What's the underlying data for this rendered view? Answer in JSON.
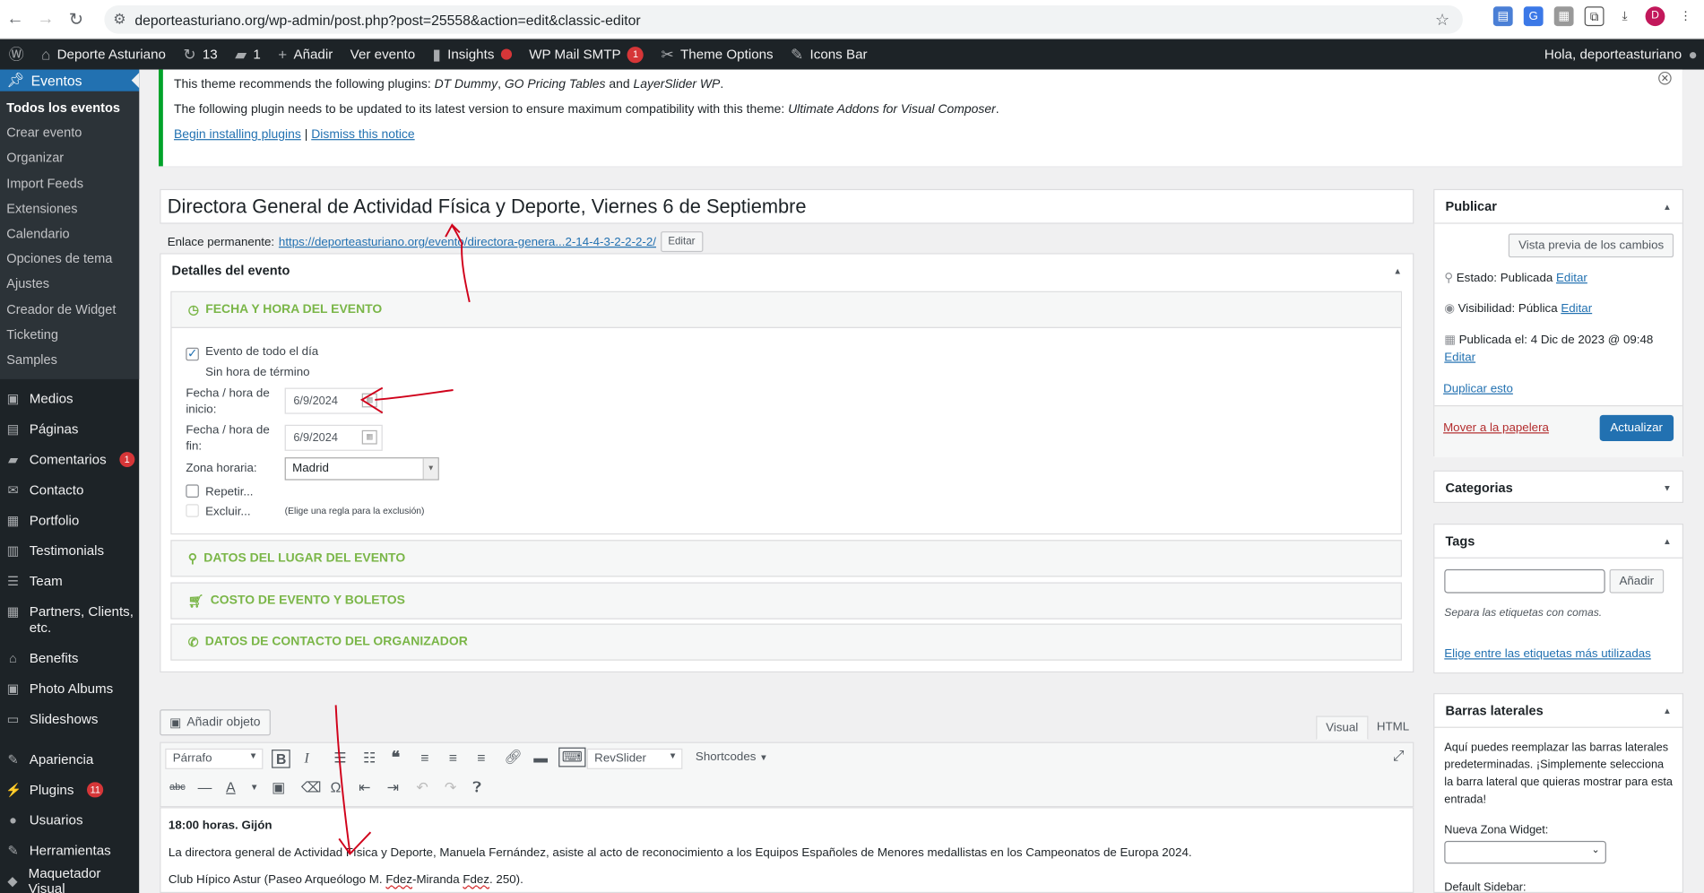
{
  "browser": {
    "url": "deporteasturiano.org/wp-admin/post.php?post=25558&action=edit&classic-editor",
    "avatar_letter": "D"
  },
  "adminbar": {
    "site": "Deporte Asturiano",
    "updates": "13",
    "comments": "1",
    "new": "Añadir",
    "view": "Ver evento",
    "insights": "Insights",
    "smtp": "WP Mail SMTP",
    "smtp_count": "1",
    "theme_options": "Theme Options",
    "icons_bar": "Icons Bar",
    "greeting": "Hola, deporteasturiano"
  },
  "sidebar": {
    "current": "Eventos",
    "submenu": [
      "Todos los eventos",
      "Crear evento",
      "Organizar",
      "Import Feeds",
      "Extensiones",
      "Calendario",
      "Opciones de tema",
      "Ajustes",
      "Creador de Widget",
      "Ticketing",
      "Samples"
    ],
    "items": [
      {
        "label": "Medios",
        "icon": "▣"
      },
      {
        "label": "Páginas",
        "icon": "▤"
      },
      {
        "label": "Comentarios",
        "icon": "▰",
        "badge": "1"
      },
      {
        "label": "Contacto",
        "icon": "✉"
      },
      {
        "label": "Portfolio",
        "icon": "▦"
      },
      {
        "label": "Testimonials",
        "icon": "▥"
      },
      {
        "label": "Team",
        "icon": "☰"
      },
      {
        "label": "Partners, Clients, etc.",
        "icon": "▦"
      },
      {
        "label": "Benefits",
        "icon": "⌂"
      },
      {
        "label": "Photo Albums",
        "icon": "▣"
      },
      {
        "label": "Slideshows",
        "icon": "▭"
      },
      {
        "label": "Apariencia",
        "icon": "✎"
      },
      {
        "label": "Plugins",
        "icon": "⚡",
        "badge": "11"
      },
      {
        "label": "Usuarios",
        "icon": "●"
      },
      {
        "label": "Herramientas",
        "icon": "✎"
      },
      {
        "label": "Maquetador Visual",
        "icon": "◆"
      }
    ]
  },
  "notice": {
    "line1_pre": "This theme recommends the following plugins: ",
    "line1_p1": "DT Dummy",
    "line1_sep1": ", ",
    "line1_p2": "GO Pricing Tables",
    "line1_and": " and ",
    "line1_p3": "LayerSlider WP",
    "line1_end": ".",
    "line2_pre": "The following plugin needs to be updated to its latest version to ensure maximum compatibility with this theme: ",
    "line2_plugin": "Ultimate Addons for Visual Composer",
    "line2_end": ".",
    "begin": "Begin installing plugins",
    "sep": " | ",
    "dismiss": "Dismiss this notice"
  },
  "post": {
    "title": "Directora General de Actividad Física y Deporte, Viernes 6 de Septiembre",
    "permalink_label": "Enlace permanente:",
    "permalink": "https://deporteasturiano.org/evento/directora-genera...2-14-4-3-2-2-2-2/",
    "edit": "Editar"
  },
  "event": {
    "box_title": "Detalles del evento",
    "date_section": "FECHA Y HORA DEL EVENTO",
    "all_day": "Evento de todo el día",
    "no_end": "Sin hora de término",
    "start_label_1": "Fecha / hora de",
    "start_label_2": "inicio:",
    "start_value": "6/9/2024",
    "end_label_1": "Fecha / hora de",
    "end_label_2": "fin:",
    "end_value": "6/9/2024",
    "tz_label": "Zona horaria:",
    "tz_value": "Madrid",
    "repeat": "Repetir...",
    "exclude": "Excluir...",
    "exclude_hint": "(Elige una regla para la exclusión)",
    "venue": "DATOS DEL LUGAR DEL EVENTO",
    "cost": "COSTO DE EVENTO Y BOLETOS",
    "organizer": "DATOS DE CONTACTO DEL ORGANIZADOR"
  },
  "editor": {
    "add_media": "Añadir objeto",
    "tab_visual": "Visual",
    "tab_html": "HTML",
    "format": "Párrafo",
    "revslider": "RevSlider",
    "shortcodes": "Shortcodes",
    "line1": "18:00 horas. Gijón",
    "line2": "La directora general de Actividad Física y Deporte, Manuela Fernández, asiste al acto de reconocimiento a los Equipos Españoles de Menores medallistas en los Campeonatos de Europa 2024.",
    "line3_a": "Club Hípico Astur  (Paseo Arqueólogo M. ",
    "line3_b": "Fdez",
    "line3_c": "-Miranda ",
    "line3_d": "Fdez",
    ". 250).": "",
    "line3_e": ". 250)."
  },
  "publish": {
    "title": "Publicar",
    "preview": "Vista previa de los cambios",
    "status_label": "Estado:",
    "status": "Publicada",
    "visibility_label": "Visibilidad:",
    "visibility": "Pública",
    "published_label": "Publicada el:",
    "published": "4 Dic de 2023 @ 09:48",
    "edit": "Editar",
    "duplicate": "Duplicar esto",
    "trash": "Mover a la papelera",
    "update": "Actualizar"
  },
  "categories": {
    "title": "Categorias"
  },
  "tags": {
    "title": "Tags",
    "add": "Añadir",
    "hint": "Separa las etiquetas con comas.",
    "choose": "Elige entre las etiquetas más utilizadas"
  },
  "sidebars": {
    "title": "Barras laterales",
    "desc": "Aquí puedes reemplazar las barras laterales predeterminadas. ¡Simplemente selecciona la barra lateral que quieras mostrar para esta entrada!",
    "new_zone": "Nueva Zona Widget:",
    "default": "Default Sidebar:"
  },
  "colors": {
    "admin_dark": "#1d2327",
    "accent": "#2271b1",
    "green": "#7ab648",
    "annotation": "#d0021b"
  }
}
